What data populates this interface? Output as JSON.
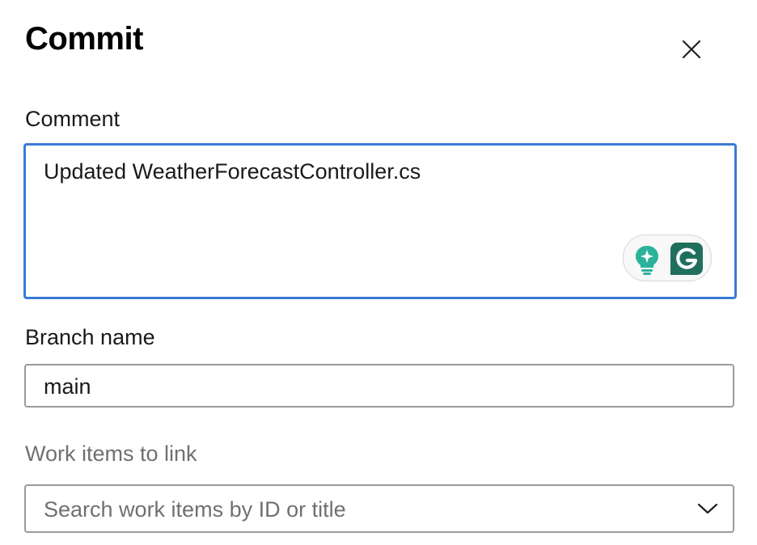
{
  "dialog": {
    "title": "Commit",
    "close_icon": "close-icon"
  },
  "comment": {
    "label": "Comment",
    "value": "Updated WeatherForecastController.cs",
    "focus_color": "#3a7bd5",
    "assistant_icons": [
      "lightbulb-sparkle-icon",
      "grammarly-icon"
    ]
  },
  "branch": {
    "label": "Branch name",
    "value": "main"
  },
  "work_items": {
    "label": "Work items to link",
    "placeholder": "Search work items by ID or title",
    "dropdown_icon": "chevron-down-icon"
  }
}
